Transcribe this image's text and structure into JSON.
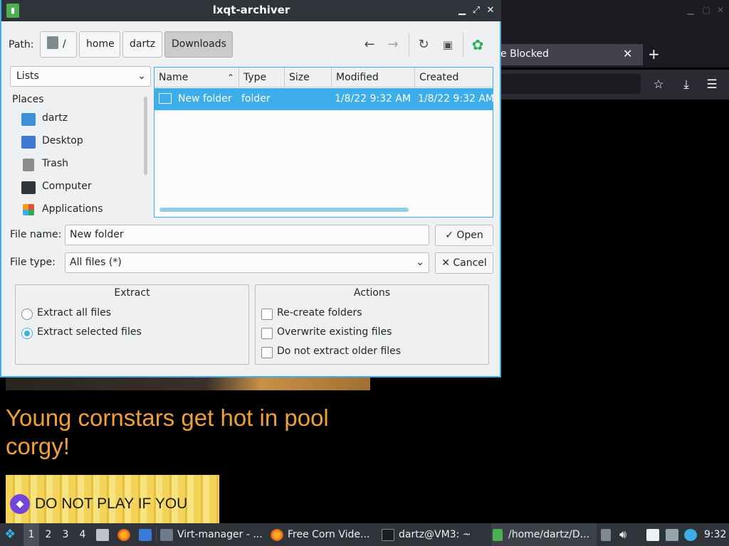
{
  "browser": {
    "tab_title": "e Blocked",
    "tab_close": "✕",
    "new_tab": "+",
    "window_controls": [
      "minimize-icon",
      "maximize-icon",
      "close-icon"
    ],
    "toolbar_icons": [
      "star-icon",
      "download-icon",
      "menu-icon"
    ],
    "page": {
      "heading": "Young cornstars get hot in pool corgy!",
      "banner_text": "DO NOT PLAY IF YOU"
    }
  },
  "dialog": {
    "title": "lxqt-archiver",
    "path_label": "Path:",
    "breadcrumbs": [
      "/",
      "home",
      "dartz",
      "Downloads"
    ],
    "lists_combo": "Lists",
    "places_heading": "Places",
    "places": [
      {
        "label": "dartz",
        "icon": "home-folder-icon",
        "color": "#3d8fd6"
      },
      {
        "label": "Desktop",
        "icon": "desktop-icon",
        "color": "#3d7ad6"
      },
      {
        "label": "Trash",
        "icon": "trash-icon",
        "color": "#8a8c8d"
      },
      {
        "label": "Computer",
        "icon": "computer-icon",
        "color": "#31363b"
      },
      {
        "label": "Applications",
        "icon": "applications-icon",
        "color": "#e74c3c"
      }
    ],
    "columns": [
      "Name",
      "Type",
      "Size",
      "Modified",
      "Created"
    ],
    "rows": [
      {
        "name": "New folder",
        "type": "folder",
        "size": "",
        "modified": "1/8/22 9:32 AM",
        "created": "1/8/22 9:32 AM"
      }
    ],
    "filename_label": "File name:",
    "filename_value": "New folder",
    "filetype_label": "File type:",
    "filetype_value": "All files (*)",
    "open_button": "Open",
    "cancel_button": "Cancel",
    "extract_group": {
      "title": "Extract",
      "options": [
        {
          "label": "Extract all files",
          "selected": false
        },
        {
          "label": "Extract selected files",
          "selected": true
        }
      ]
    },
    "actions_group": {
      "title": "Actions",
      "options": [
        {
          "label": "Re-create folders",
          "checked": false
        },
        {
          "label": "Overwrite existing files",
          "checked": false
        },
        {
          "label": "Do not extract older files",
          "checked": false
        }
      ]
    },
    "accent_color": "#3daee9"
  },
  "taskbar": {
    "desktops": [
      "1",
      "2",
      "3",
      "4"
    ],
    "tasks": [
      {
        "label": "Virt-manager - ...",
        "icon": "virt-manager-icon"
      },
      {
        "label": "Free Corn Vide...",
        "icon": "firefox-icon"
      },
      {
        "label": "dartz@VM3: ~",
        "icon": "terminal-icon"
      },
      {
        "label": "/home/dartz/D...",
        "icon": "archiver-icon"
      }
    ],
    "clock": "9:32"
  }
}
